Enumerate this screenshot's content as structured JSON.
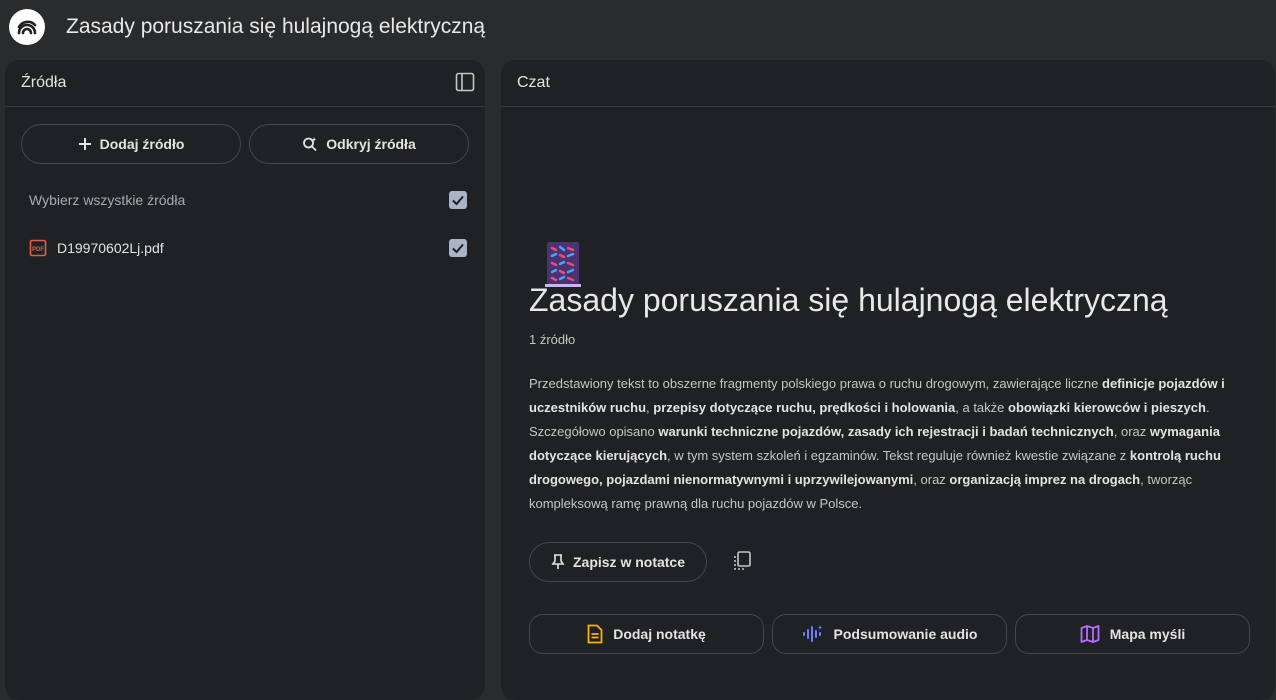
{
  "app": {
    "title": "Zasady poruszania się hulajnogą elektryczną"
  },
  "sources_panel": {
    "title": "Źródła",
    "add_source_label": "Dodaj źródło",
    "discover_sources_label": "Odkryj źródła",
    "select_all_label": "Wybierz wszystkie źródła",
    "items": [
      {
        "name": "D19970602Lj.pdf",
        "icon": "pdf-icon"
      }
    ]
  },
  "chat_panel": {
    "title": "Czat",
    "notebook_title": "Zasady poruszania się hulajnogą elektryczną",
    "source_count": "1 źródło",
    "summary_segments": [
      {
        "t": "Przedstawiony tekst to obszerne fragmenty polskiego prawa o ruchu drogowym, zawierające liczne ",
        "b": false
      },
      {
        "t": "definicje pojazdów i uczestników ruchu",
        "b": true
      },
      {
        "t": ", ",
        "b": false
      },
      {
        "t": "przepisy dotyczące ruchu, prędkości i holowania",
        "b": true
      },
      {
        "t": ", a także ",
        "b": false
      },
      {
        "t": "obowiązki kierowców i pieszych",
        "b": true
      },
      {
        "t": ". Szczegółowo opisano ",
        "b": false
      },
      {
        "t": "warunki techniczne pojazdów, zasady ich rejestracji i badań technicznych",
        "b": true
      },
      {
        "t": ", oraz ",
        "b": false
      },
      {
        "t": "wymagania dotyczące kierujących",
        "b": true
      },
      {
        "t": ", w tym system szkoleń i egzaminów. Tekst reguluje również kwestie związane z ",
        "b": false
      },
      {
        "t": "kontrolą ruchu drogowego, pojazdami nienormatywnymi i uprzywilejowanymi",
        "b": true
      },
      {
        "t": ", oraz ",
        "b": false
      },
      {
        "t": "organizacją imprez na drogach",
        "b": true
      },
      {
        "t": ", tworząc kompleksową ramę prawną dla ruchu pojazdów w Polsce.",
        "b": false
      }
    ],
    "save_note_label": "Zapisz w notatce",
    "actions": {
      "add_note": "Dodaj notatkę",
      "audio_summary": "Podsumowanie audio",
      "mind_map": "Mapa myśli"
    }
  },
  "colors": {
    "pdf_red": "#e25d4a",
    "note_yellow": "#f9b208",
    "audio_blue": "#6e7cff",
    "mindmap_purple": "#b56cff"
  }
}
